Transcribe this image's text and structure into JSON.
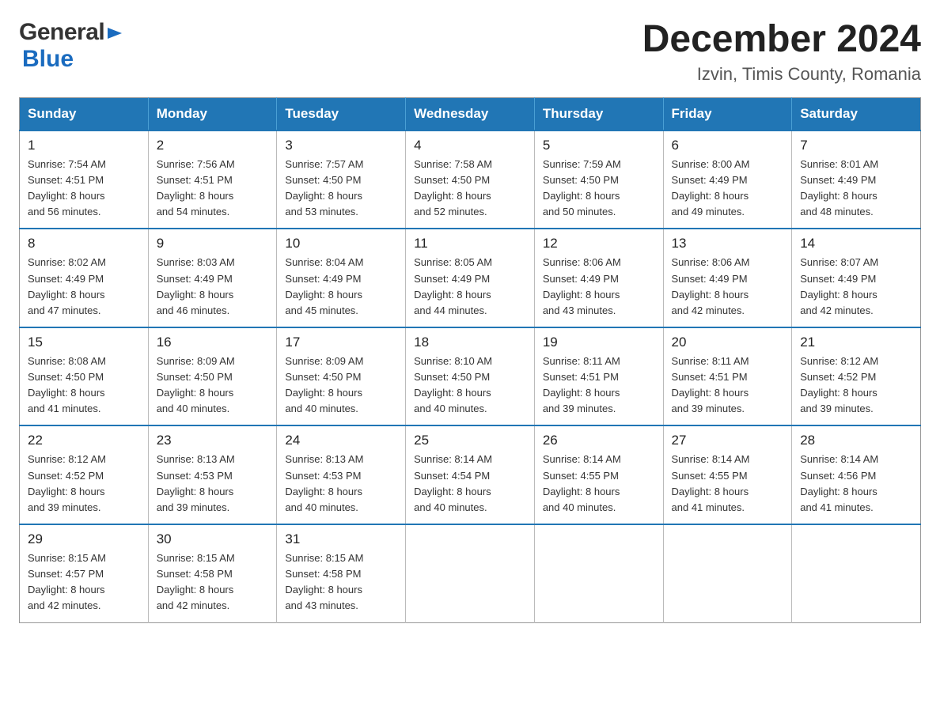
{
  "header": {
    "logo_general": "General",
    "logo_blue": "Blue",
    "month_title": "December 2024",
    "location": "Izvin, Timis County, Romania"
  },
  "days_of_week": [
    "Sunday",
    "Monday",
    "Tuesday",
    "Wednesday",
    "Thursday",
    "Friday",
    "Saturday"
  ],
  "weeks": [
    [
      {
        "day": "1",
        "sunrise": "7:54 AM",
        "sunset": "4:51 PM",
        "daylight": "8 hours and 56 minutes."
      },
      {
        "day": "2",
        "sunrise": "7:56 AM",
        "sunset": "4:51 PM",
        "daylight": "8 hours and 54 minutes."
      },
      {
        "day": "3",
        "sunrise": "7:57 AM",
        "sunset": "4:50 PM",
        "daylight": "8 hours and 53 minutes."
      },
      {
        "day": "4",
        "sunrise": "7:58 AM",
        "sunset": "4:50 PM",
        "daylight": "8 hours and 52 minutes."
      },
      {
        "day": "5",
        "sunrise": "7:59 AM",
        "sunset": "4:50 PM",
        "daylight": "8 hours and 50 minutes."
      },
      {
        "day": "6",
        "sunrise": "8:00 AM",
        "sunset": "4:49 PM",
        "daylight": "8 hours and 49 minutes."
      },
      {
        "day": "7",
        "sunrise": "8:01 AM",
        "sunset": "4:49 PM",
        "daylight": "8 hours and 48 minutes."
      }
    ],
    [
      {
        "day": "8",
        "sunrise": "8:02 AM",
        "sunset": "4:49 PM",
        "daylight": "8 hours and 47 minutes."
      },
      {
        "day": "9",
        "sunrise": "8:03 AM",
        "sunset": "4:49 PM",
        "daylight": "8 hours and 46 minutes."
      },
      {
        "day": "10",
        "sunrise": "8:04 AM",
        "sunset": "4:49 PM",
        "daylight": "8 hours and 45 minutes."
      },
      {
        "day": "11",
        "sunrise": "8:05 AM",
        "sunset": "4:49 PM",
        "daylight": "8 hours and 44 minutes."
      },
      {
        "day": "12",
        "sunrise": "8:06 AM",
        "sunset": "4:49 PM",
        "daylight": "8 hours and 43 minutes."
      },
      {
        "day": "13",
        "sunrise": "8:06 AM",
        "sunset": "4:49 PM",
        "daylight": "8 hours and 42 minutes."
      },
      {
        "day": "14",
        "sunrise": "8:07 AM",
        "sunset": "4:49 PM",
        "daylight": "8 hours and 42 minutes."
      }
    ],
    [
      {
        "day": "15",
        "sunrise": "8:08 AM",
        "sunset": "4:50 PM",
        "daylight": "8 hours and 41 minutes."
      },
      {
        "day": "16",
        "sunrise": "8:09 AM",
        "sunset": "4:50 PM",
        "daylight": "8 hours and 40 minutes."
      },
      {
        "day": "17",
        "sunrise": "8:09 AM",
        "sunset": "4:50 PM",
        "daylight": "8 hours and 40 minutes."
      },
      {
        "day": "18",
        "sunrise": "8:10 AM",
        "sunset": "4:50 PM",
        "daylight": "8 hours and 40 minutes."
      },
      {
        "day": "19",
        "sunrise": "8:11 AM",
        "sunset": "4:51 PM",
        "daylight": "8 hours and 39 minutes."
      },
      {
        "day": "20",
        "sunrise": "8:11 AM",
        "sunset": "4:51 PM",
        "daylight": "8 hours and 39 minutes."
      },
      {
        "day": "21",
        "sunrise": "8:12 AM",
        "sunset": "4:52 PM",
        "daylight": "8 hours and 39 minutes."
      }
    ],
    [
      {
        "day": "22",
        "sunrise": "8:12 AM",
        "sunset": "4:52 PM",
        "daylight": "8 hours and 39 minutes."
      },
      {
        "day": "23",
        "sunrise": "8:13 AM",
        "sunset": "4:53 PM",
        "daylight": "8 hours and 39 minutes."
      },
      {
        "day": "24",
        "sunrise": "8:13 AM",
        "sunset": "4:53 PM",
        "daylight": "8 hours and 40 minutes."
      },
      {
        "day": "25",
        "sunrise": "8:14 AM",
        "sunset": "4:54 PM",
        "daylight": "8 hours and 40 minutes."
      },
      {
        "day": "26",
        "sunrise": "8:14 AM",
        "sunset": "4:55 PM",
        "daylight": "8 hours and 40 minutes."
      },
      {
        "day": "27",
        "sunrise": "8:14 AM",
        "sunset": "4:55 PM",
        "daylight": "8 hours and 41 minutes."
      },
      {
        "day": "28",
        "sunrise": "8:14 AM",
        "sunset": "4:56 PM",
        "daylight": "8 hours and 41 minutes."
      }
    ],
    [
      {
        "day": "29",
        "sunrise": "8:15 AM",
        "sunset": "4:57 PM",
        "daylight": "8 hours and 42 minutes."
      },
      {
        "day": "30",
        "sunrise": "8:15 AM",
        "sunset": "4:58 PM",
        "daylight": "8 hours and 42 minutes."
      },
      {
        "day": "31",
        "sunrise": "8:15 AM",
        "sunset": "4:58 PM",
        "daylight": "8 hours and 43 minutes."
      },
      null,
      null,
      null,
      null
    ]
  ],
  "labels": {
    "sunrise": "Sunrise:",
    "sunset": "Sunset:",
    "daylight": "Daylight:"
  }
}
